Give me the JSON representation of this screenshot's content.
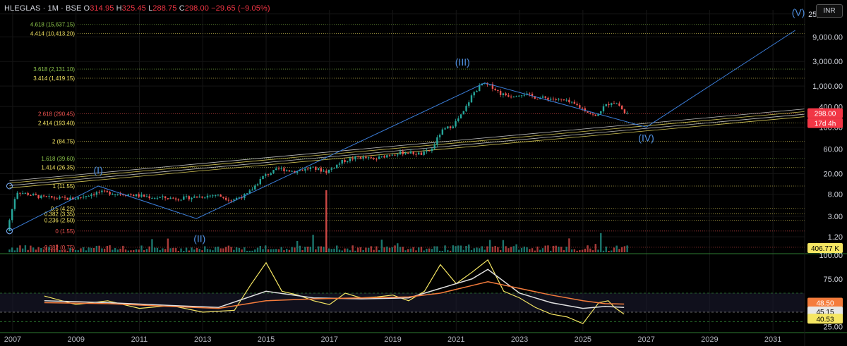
{
  "header": {
    "symbol": "HLEGLAS · 1M · BSE",
    "open_label": "O",
    "open": "314.95",
    "high_label": "H",
    "high": "325.45",
    "low_label": "L",
    "low": "288.75",
    "close_label": "C",
    "close": "298.00",
    "change": "−29.65 (−9.05%)"
  },
  "currency_button": "INR",
  "colors": {
    "up": "#26a69a",
    "down": "#ef5350",
    "wave": "#3b7dd8",
    "grid": "#1e1e1e",
    "fib": "#9e9e3a",
    "rsi": "#f5e663",
    "rsi_ma": "#e0e0e0",
    "rsi_ma2": "#f57c3c"
  },
  "chart_data": [
    {
      "type": "line",
      "title": "",
      "scale": "log",
      "ylim": [
        0.6,
        30000
      ],
      "xlim": [
        2006.6,
        2032.0
      ],
      "x_ticks": [
        "2007",
        "2009",
        "2011",
        "2013",
        "2015",
        "2017",
        "2019",
        "2021",
        "2023",
        "2025",
        "2027",
        "2029",
        "2031"
      ],
      "y_ticks": [
        "25,000.00",
        "9,000.00",
        "3,000.00",
        "1,000.00",
        "400.00",
        "160.00",
        "60.00",
        "20.00",
        "8.00",
        "3.00",
        "1.20"
      ],
      "last_price_label": "298.00",
      "countdown_label": "17d 4h",
      "fib_levels": [
        {
          "label": "4.618 (15,637.15)",
          "value": 15637.15
        },
        {
          "label": "4.414 (10,413.20)",
          "value": 10413.2
        },
        {
          "label": "3.618 (2,131.10)",
          "value": 2131.1
        },
        {
          "label": "3.414 (1,419.15)",
          "value": 1419.15
        },
        {
          "label": "2.618 (290.45)",
          "value": 290.45
        },
        {
          "label": "2.414 (193.40)",
          "value": 193.4
        },
        {
          "label": "2 (84.75)",
          "value": 84.75
        },
        {
          "label": "1.618 (39.60)",
          "value": 39.6
        },
        {
          "label": "1.414 (26.35)",
          "value": 26.35
        },
        {
          "label": "1 (11.55)",
          "value": 11.55
        },
        {
          "label": "0.5 (4.25)",
          "value": 4.25
        },
        {
          "label": "0.382 (3.35)",
          "value": 3.35
        },
        {
          "label": "0.236 (2.50)",
          "value": 2.5
        },
        {
          "label": "0 (1.55)",
          "value": 1.55
        },
        {
          "label": "-0.382 (0.75)",
          "value": 0.75
        }
      ],
      "series": [
        {
          "values": [
            [
              2006.9,
              1.55
            ],
            [
              2007.2,
              9.0
            ],
            [
              2008.0,
              7.0
            ],
            [
              2009.0,
              6.5
            ],
            [
              2009.8,
              8.8
            ],
            [
              2010.5,
              8.2
            ],
            [
              2011.5,
              7.0
            ],
            [
              2012.3,
              6.6
            ],
            [
              2013.0,
              7.2
            ],
            [
              2013.5,
              7.8
            ],
            [
              2014.0,
              6.2
            ],
            [
              2014.5,
              8.0
            ],
            [
              2015.0,
              18
            ],
            [
              2015.5,
              25
            ],
            [
              2016.0,
              22
            ],
            [
              2016.5,
              26
            ],
            [
              2017.0,
              22
            ],
            [
              2017.5,
              35
            ],
            [
              2018.0,
              42
            ],
            [
              2018.5,
              38
            ],
            [
              2019.0,
              48
            ],
            [
              2019.5,
              52
            ],
            [
              2020.0,
              48
            ],
            [
              2020.3,
              58
            ],
            [
              2020.6,
              130
            ],
            [
              2021.0,
              180
            ],
            [
              2021.3,
              300
            ],
            [
              2021.6,
              700
            ],
            [
              2021.9,
              1100
            ],
            [
              2022.2,
              1000
            ],
            [
              2022.5,
              700
            ],
            [
              2022.8,
              650
            ],
            [
              2023.2,
              720
            ],
            [
              2023.6,
              600
            ],
            [
              2024.0,
              580
            ],
            [
              2024.5,
              520
            ],
            [
              2024.9,
              420
            ],
            [
              2025.2,
              330
            ],
            [
              2025.5,
              250
            ],
            [
              2025.7,
              380
            ],
            [
              2026.0,
              500
            ],
            [
              2026.2,
              450
            ],
            [
              2026.4,
              298
            ]
          ]
        },
        {
          "values": [
            [
              2006.9,
              1.55
            ],
            [
              2009.7,
              11.55
            ],
            [
              2012.8,
              2.7
            ],
            [
              2021.9,
              1150
            ],
            [
              2027.0,
              160
            ],
            [
              2031.7,
              12000
            ]
          ]
        }
      ],
      "wave_labels": [
        "(I)",
        "(II)",
        "(III)",
        "(IV)",
        "(V)"
      ],
      "volume_label": "406.77 K"
    },
    {
      "type": "line",
      "title": "",
      "ylim": [
        20,
        100
      ],
      "y_ticks": [
        "100.00",
        "75.00",
        "50.00",
        "25.00"
      ],
      "values_labels": [
        "48.50",
        "45.15",
        "40.53"
      ],
      "series": [
        {
          "values": [
            [
              2008.0,
              57
            ],
            [
              2009.0,
              48
            ],
            [
              2010.0,
              52
            ],
            [
              2011.0,
              44
            ],
            [
              2012.0,
              47
            ],
            [
              2013.0,
              40
            ],
            [
              2014.0,
              42
            ],
            [
              2014.5,
              68
            ],
            [
              2015.0,
              92
            ],
            [
              2015.5,
              62
            ],
            [
              2016.0,
              58
            ],
            [
              2016.5,
              52
            ],
            [
              2017.0,
              48
            ],
            [
              2017.5,
              60
            ],
            [
              2018.0,
              55
            ],
            [
              2018.5,
              56
            ],
            [
              2019.0,
              58
            ],
            [
              2019.5,
              52
            ],
            [
              2020.0,
              62
            ],
            [
              2020.5,
              90
            ],
            [
              2021.0,
              70
            ],
            [
              2021.5,
              82
            ],
            [
              2022.0,
              95
            ],
            [
              2022.5,
              62
            ],
            [
              2023.0,
              55
            ],
            [
              2023.5,
              45
            ],
            [
              2024.0,
              38
            ],
            [
              2024.5,
              35
            ],
            [
              2025.0,
              28
            ],
            [
              2025.5,
              50
            ],
            [
              2025.8,
              52
            ],
            [
              2026.0,
              45
            ],
            [
              2026.3,
              38
            ]
          ]
        },
        {
          "values": [
            [
              2008.0,
              52
            ],
            [
              2010.0,
              50
            ],
            [
              2012.0,
              47
            ],
            [
              2013.5,
              45
            ],
            [
              2015.0,
              62
            ],
            [
              2016.5,
              55
            ],
            [
              2018.0,
              54
            ],
            [
              2019.5,
              55
            ],
            [
              2020.5,
              65
            ],
            [
              2021.5,
              75
            ],
            [
              2022.0,
              85
            ],
            [
              2023.0,
              60
            ],
            [
              2024.0,
              50
            ],
            [
              2025.0,
              44
            ],
            [
              2025.7,
              46
            ],
            [
              2026.3,
              45
            ]
          ]
        },
        {
          "values": [
            [
              2008.0,
              50
            ],
            [
              2010.0,
              49
            ],
            [
              2012.0,
              46
            ],
            [
              2013.5,
              44
            ],
            [
              2015.0,
              52
            ],
            [
              2016.5,
              54
            ],
            [
              2018.0,
              55
            ],
            [
              2019.5,
              56
            ],
            [
              2020.5,
              60
            ],
            [
              2021.5,
              68
            ],
            [
              2022.0,
              72
            ],
            [
              2023.0,
              65
            ],
            [
              2024.0,
              58
            ],
            [
              2025.0,
              52
            ],
            [
              2025.7,
              49
            ],
            [
              2026.3,
              48.5
            ]
          ]
        }
      ]
    }
  ]
}
